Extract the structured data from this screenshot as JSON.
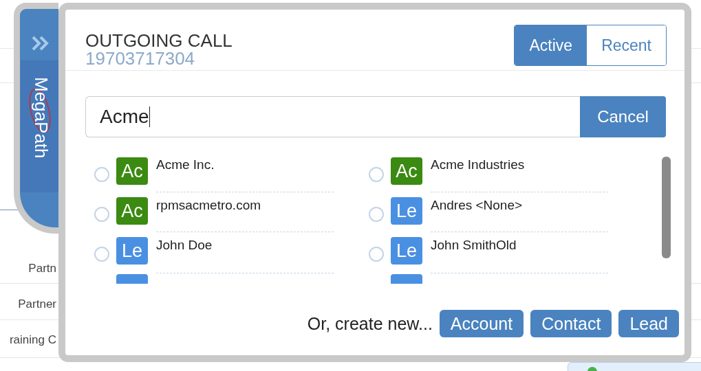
{
  "background_rows": [
    "Partn",
    "Partner",
    "raining C"
  ],
  "sidebar": {
    "logo": "MegaPath"
  },
  "header": {
    "title": "OUTGOING CALL",
    "number": "19703717304"
  },
  "tabs": [
    {
      "label": "Active",
      "selected": true
    },
    {
      "label": "Recent",
      "selected": false
    }
  ],
  "search": {
    "value": "Acme"
  },
  "cancel_button": "Cancel",
  "results": [
    {
      "badge": "Ac",
      "color": "#3b8a12",
      "name": "Acme Inc.",
      "selected": false
    },
    {
      "badge": "Ac",
      "color": "#3b8a12",
      "name": "Acme Industries",
      "selected": false
    },
    {
      "badge": "Ac",
      "color": "#3b8a12",
      "name": "rpmsacmetro.com",
      "selected": false
    },
    {
      "badge": "Le",
      "color": "#4a90e2",
      "name": "Andres <None>",
      "selected": false
    },
    {
      "badge": "Le",
      "color": "#4a90e2",
      "name": "John Doe",
      "selected": false
    },
    {
      "badge": "Le",
      "color": "#4a90e2",
      "name": "John SmithOld",
      "selected": false
    }
  ],
  "footer": {
    "prompt": "Or, create new...",
    "buttons": [
      "Account",
      "Contact",
      "Lead"
    ]
  }
}
